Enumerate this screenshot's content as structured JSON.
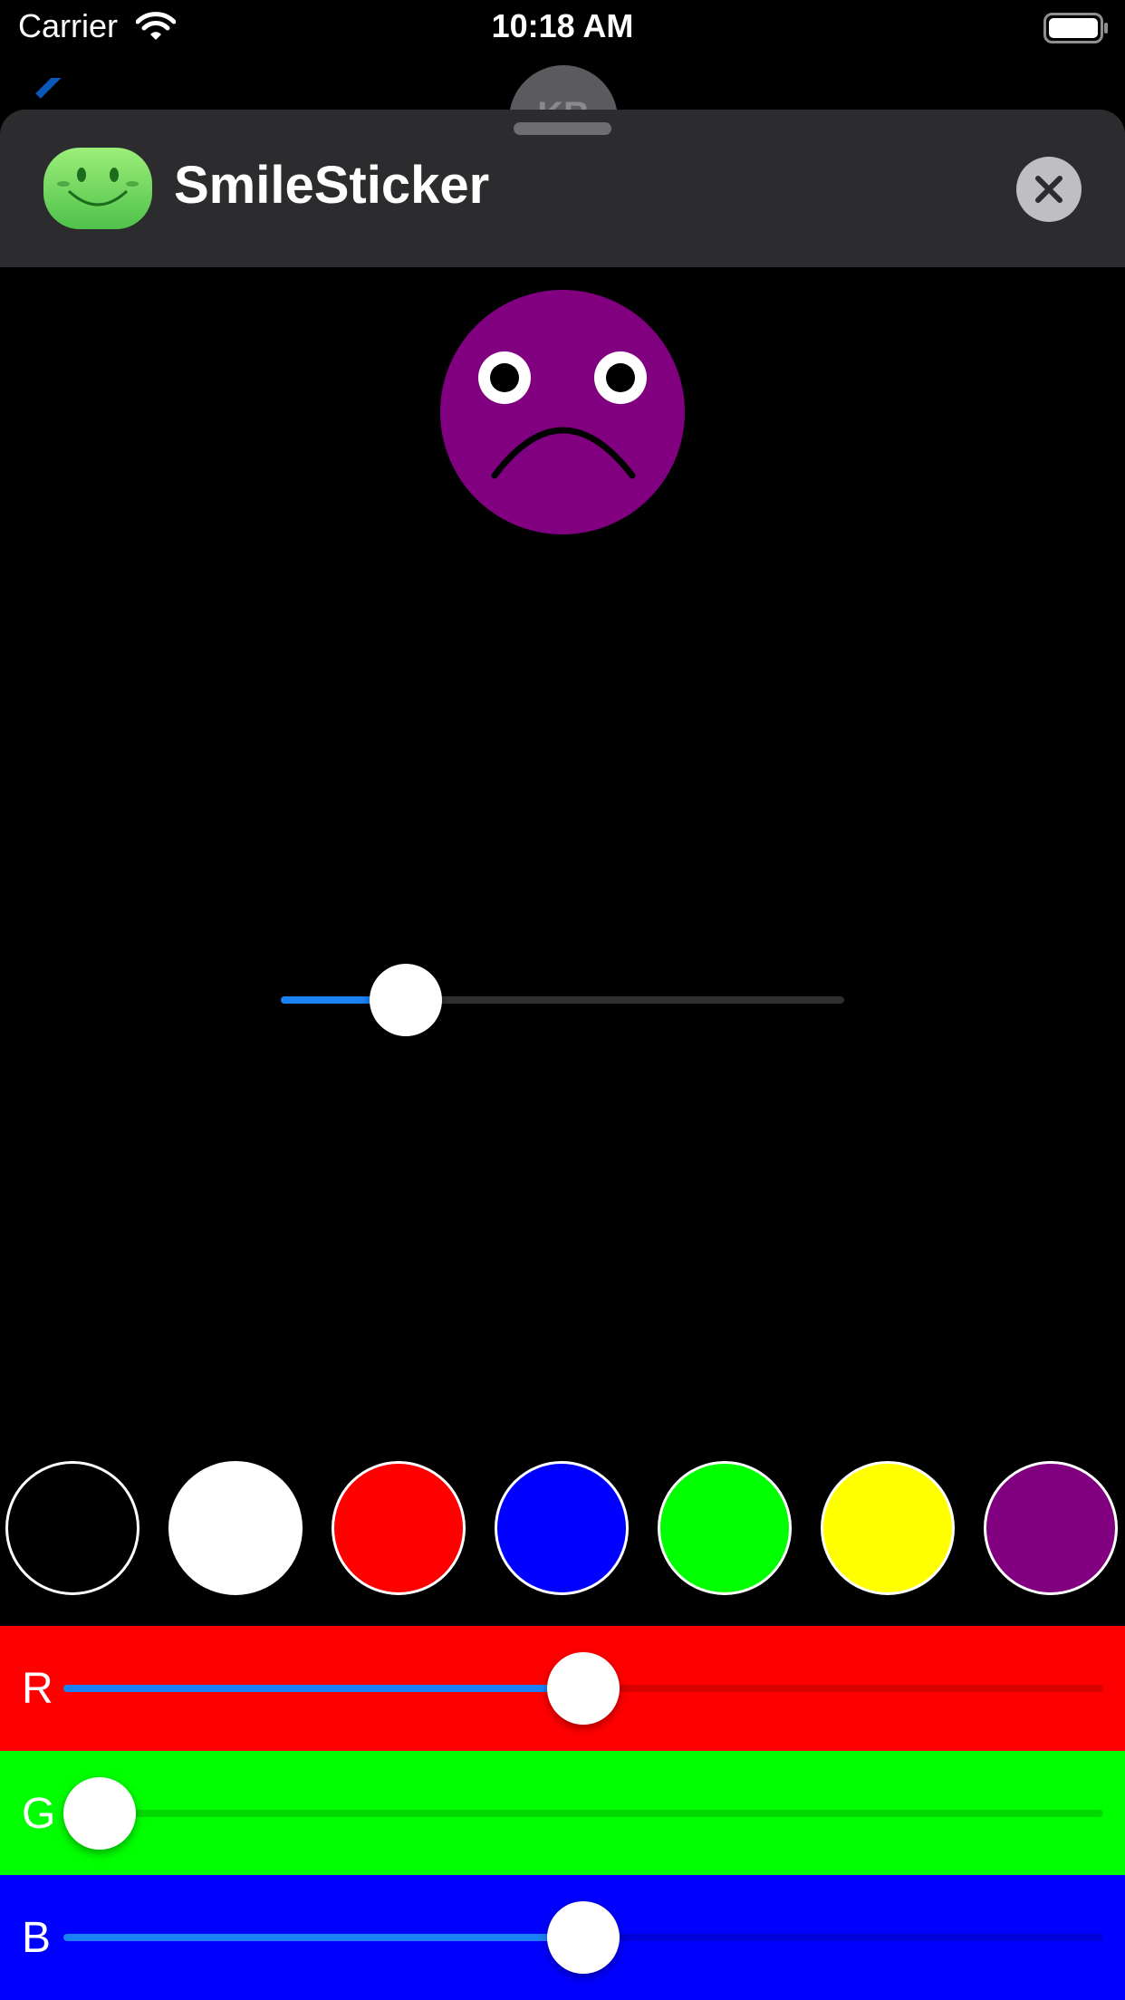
{
  "status_bar": {
    "carrier": "Carrier",
    "time": "10:18 AM"
  },
  "conversation": {
    "contact_initials": "KB"
  },
  "app": {
    "title": "SmileSticker"
  },
  "face": {
    "color": "#800080",
    "expression": "sad"
  },
  "size_slider": {
    "value": 0.18,
    "accent": "#1b82f5"
  },
  "swatches": [
    {
      "name": "black",
      "color": "#000000"
    },
    {
      "name": "white",
      "color": "#ffffff"
    },
    {
      "name": "red",
      "color": "#ff0000"
    },
    {
      "name": "blue",
      "color": "#0000ff"
    },
    {
      "name": "green",
      "color": "#00ff00"
    },
    {
      "name": "yellow",
      "color": "#ffff00"
    },
    {
      "name": "purple",
      "color": "#800080"
    }
  ],
  "rgb": {
    "r": {
      "label": "R",
      "value": 0.5,
      "background": "#ff0000"
    },
    "g": {
      "label": "G",
      "value": 0.0,
      "background": "#00ff00"
    },
    "b": {
      "label": "B",
      "value": 0.5,
      "background": "#0000ff"
    }
  }
}
